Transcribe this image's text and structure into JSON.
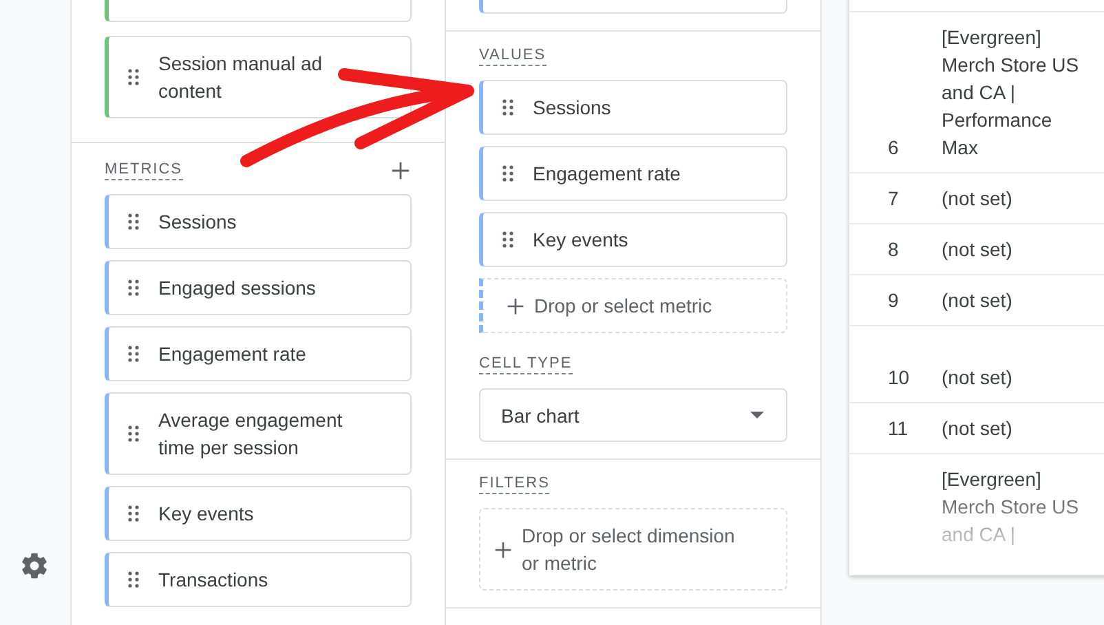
{
  "dimensions": {
    "items": [
      {
        "kind": "partial"
      },
      {
        "kind": "full",
        "label": "Session manual ad\ncontent"
      }
    ]
  },
  "metrics": {
    "title": "METRICS",
    "items": [
      {
        "label": "Sessions"
      },
      {
        "label": "Engaged sessions"
      },
      {
        "label": "Engagement rate"
      },
      {
        "label": "Average engagement\ntime per session"
      },
      {
        "label": "Key events"
      },
      {
        "label": "Transactions"
      }
    ]
  },
  "values": {
    "title": "VALUES",
    "items": [
      {
        "label": "Sessions"
      },
      {
        "label": "Engagement rate"
      },
      {
        "label": "Key events"
      }
    ],
    "drop_zone": "Drop or select metric"
  },
  "cell_type": {
    "title": "CELL TYPE",
    "value": "Bar chart"
  },
  "filters": {
    "title": "FILTERS",
    "drop_zone": "Drop or select dimension\nor metric"
  },
  "table": {
    "rows": [
      {
        "index": "6",
        "name": "[Evergreen]\nMerch Store US\nand CA |\nPerformance\nMax"
      },
      {
        "index": "7",
        "name": "(not set)"
      },
      {
        "index": "8",
        "name": "(not set)"
      },
      {
        "index": "9",
        "name": "(not set)"
      },
      {
        "index": "10",
        "name": "(not set)"
      },
      {
        "index": "11",
        "name": "(not set)"
      },
      {
        "index": "",
        "name": "[Evergreen]\nMerch Store US\nand CA |"
      }
    ]
  }
}
